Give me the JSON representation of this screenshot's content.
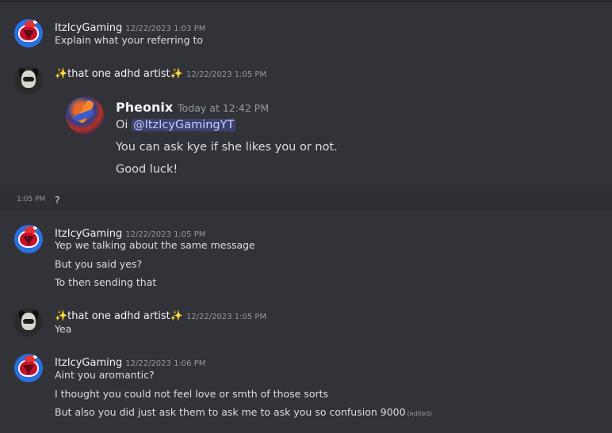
{
  "messages": {
    "m1": {
      "user": "ItzIcyGaming",
      "timestamp": "12/22/2023 1:03 PM",
      "lines": [
        "Explain what your referring to"
      ]
    },
    "m2": {
      "user": "✨that one adhd artist✨",
      "timestamp": "12/22/2023 1:05 PM",
      "embed": {
        "author": "Pheonix",
        "timestamp": "Today at 12:42 PM",
        "line1_prefix": "Oi ",
        "mention": "@ItzIcyGamingYT",
        "line2": "You can ask kye if she likes you or not.",
        "line3": "Good luck!"
      }
    },
    "m2b": {
      "side_timestamp": "1:05 PM",
      "text": "?"
    },
    "m3": {
      "user": "ItzIcyGaming",
      "timestamp": "12/22/2023 1:05 PM",
      "lines": [
        "Yep we talking about the same message",
        "But you said yes?",
        "To then sending that"
      ]
    },
    "m4": {
      "user": "✨that one adhd artist✨",
      "timestamp": "12/22/2023 1:05 PM",
      "lines": [
        "Yea"
      ]
    },
    "m5": {
      "user": "ItzIcyGaming",
      "timestamp": "12/22/2023 1:06 PM",
      "lines": [
        "Aint you aromantic?",
        "I thought you could not feel love or smth of those sorts",
        "But also you did just ask them to ask me to ask you so confusion 9000"
      ],
      "edited": "(edited)"
    }
  },
  "colors": {
    "background": "#313338",
    "mention_bg": "#3c4270",
    "mention_text": "#c9cdfb"
  },
  "icons": {
    "avatar_icy": "avatar-icon",
    "avatar_artist": "avatar-icon",
    "avatar_pheonix": "avatar-icon"
  }
}
